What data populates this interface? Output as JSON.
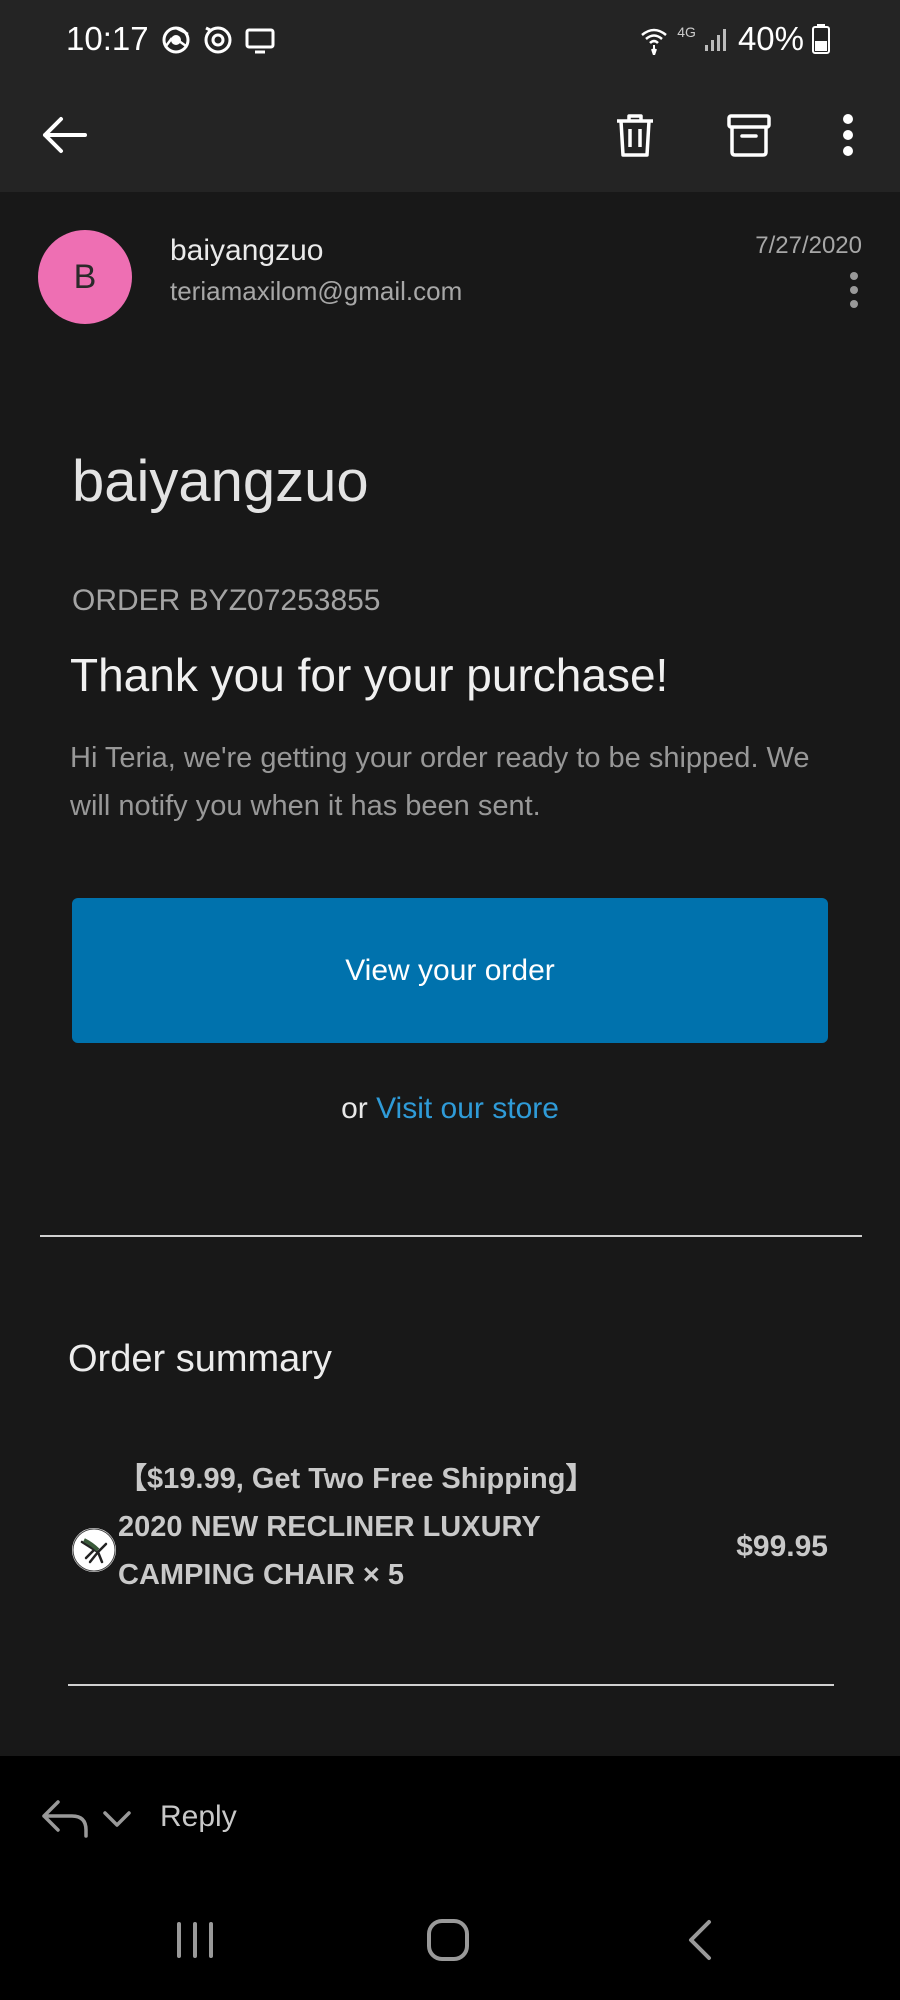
{
  "status_bar": {
    "time": "10:17",
    "battery": "40%",
    "network_label": "4G"
  },
  "sender": {
    "avatar_letter": "B",
    "name": "baiyangzuo",
    "email": "teriamaxilom@gmail.com",
    "date": "7/27/2020",
    "avatar_color": "#ee6fb3"
  },
  "email_body": {
    "shop_name": "baiyangzuo",
    "order_number": "ORDER BYZ07253855",
    "heading": "Thank you for your purchase!",
    "intro": "Hi Teria, we're getting your order ready to be shipped. We will notify you when it has been sent.",
    "view_order_button": "View your order",
    "or_text": "or ",
    "visit_store_link": "Visit our store",
    "button_color": "#0072ad",
    "link_color": "#2f9bd8"
  },
  "order_summary": {
    "title": "Order summary",
    "items": [
      {
        "name": "【$19.99, Get Two Free Shipping】2020 NEW RECLINER LUXURY CAMPING CHAIR × 5",
        "price": "$99.95"
      }
    ]
  },
  "reply_bar": {
    "label": "Reply"
  },
  "icons": {
    "appbar": [
      "back-arrow-icon",
      "delete-icon",
      "archive-icon",
      "more-vert-icon"
    ],
    "navbar": [
      "recents-icon",
      "home-icon",
      "back-icon"
    ]
  }
}
